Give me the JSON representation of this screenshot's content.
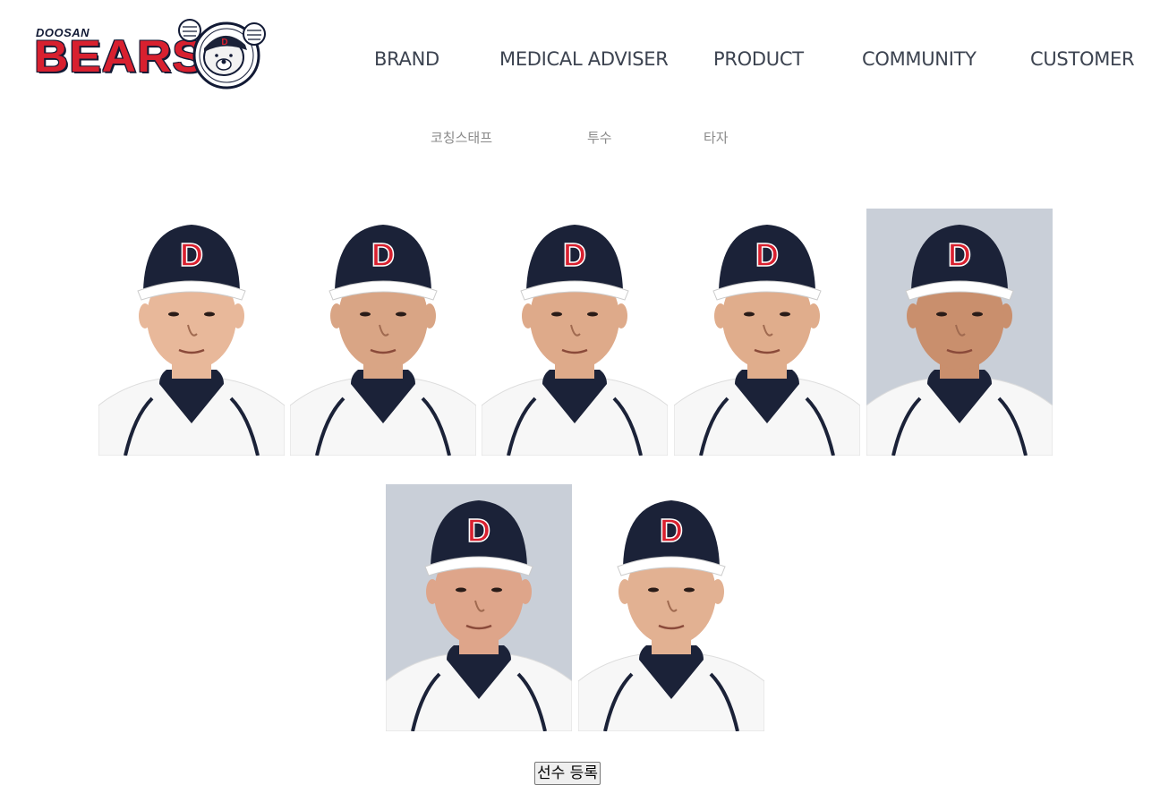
{
  "logo": {
    "small_text": "DOOSAN",
    "big_text": "BEARS",
    "mascot_icon": "bear-mascot-icon"
  },
  "nav": {
    "items": [
      {
        "label": "BRAND"
      },
      {
        "label": "MEDICAL ADVISER"
      },
      {
        "label": "PRODUCT"
      },
      {
        "label": "COMMUNITY"
      },
      {
        "label": "CUSTOMER"
      }
    ]
  },
  "tabs": {
    "items": [
      {
        "label": "코칭스태프"
      },
      {
        "label": "투수"
      },
      {
        "label": "타자"
      }
    ]
  },
  "staff": {
    "photos": [
      {
        "bg": "#ffffff",
        "skin": "#e8b89a"
      },
      {
        "bg": "#ffffff",
        "skin": "#d9a585"
      },
      {
        "bg": "#ffffff",
        "skin": "#deaa8a"
      },
      {
        "bg": "#ffffff",
        "skin": "#e0ad8c"
      },
      {
        "bg": "#c9cfd8",
        "skin": "#c98f6d"
      },
      {
        "bg": "#c9cfd8",
        "skin": "#dea58a"
      },
      {
        "bg": "#ffffff",
        "skin": "#e2b192"
      }
    ]
  },
  "colors": {
    "cap_navy": "#1b2238",
    "logo_red": "#d8202f",
    "nav_text": "#3c4350",
    "tab_text": "#8a8a8a"
  },
  "register_button": {
    "label": "선수 등록"
  }
}
